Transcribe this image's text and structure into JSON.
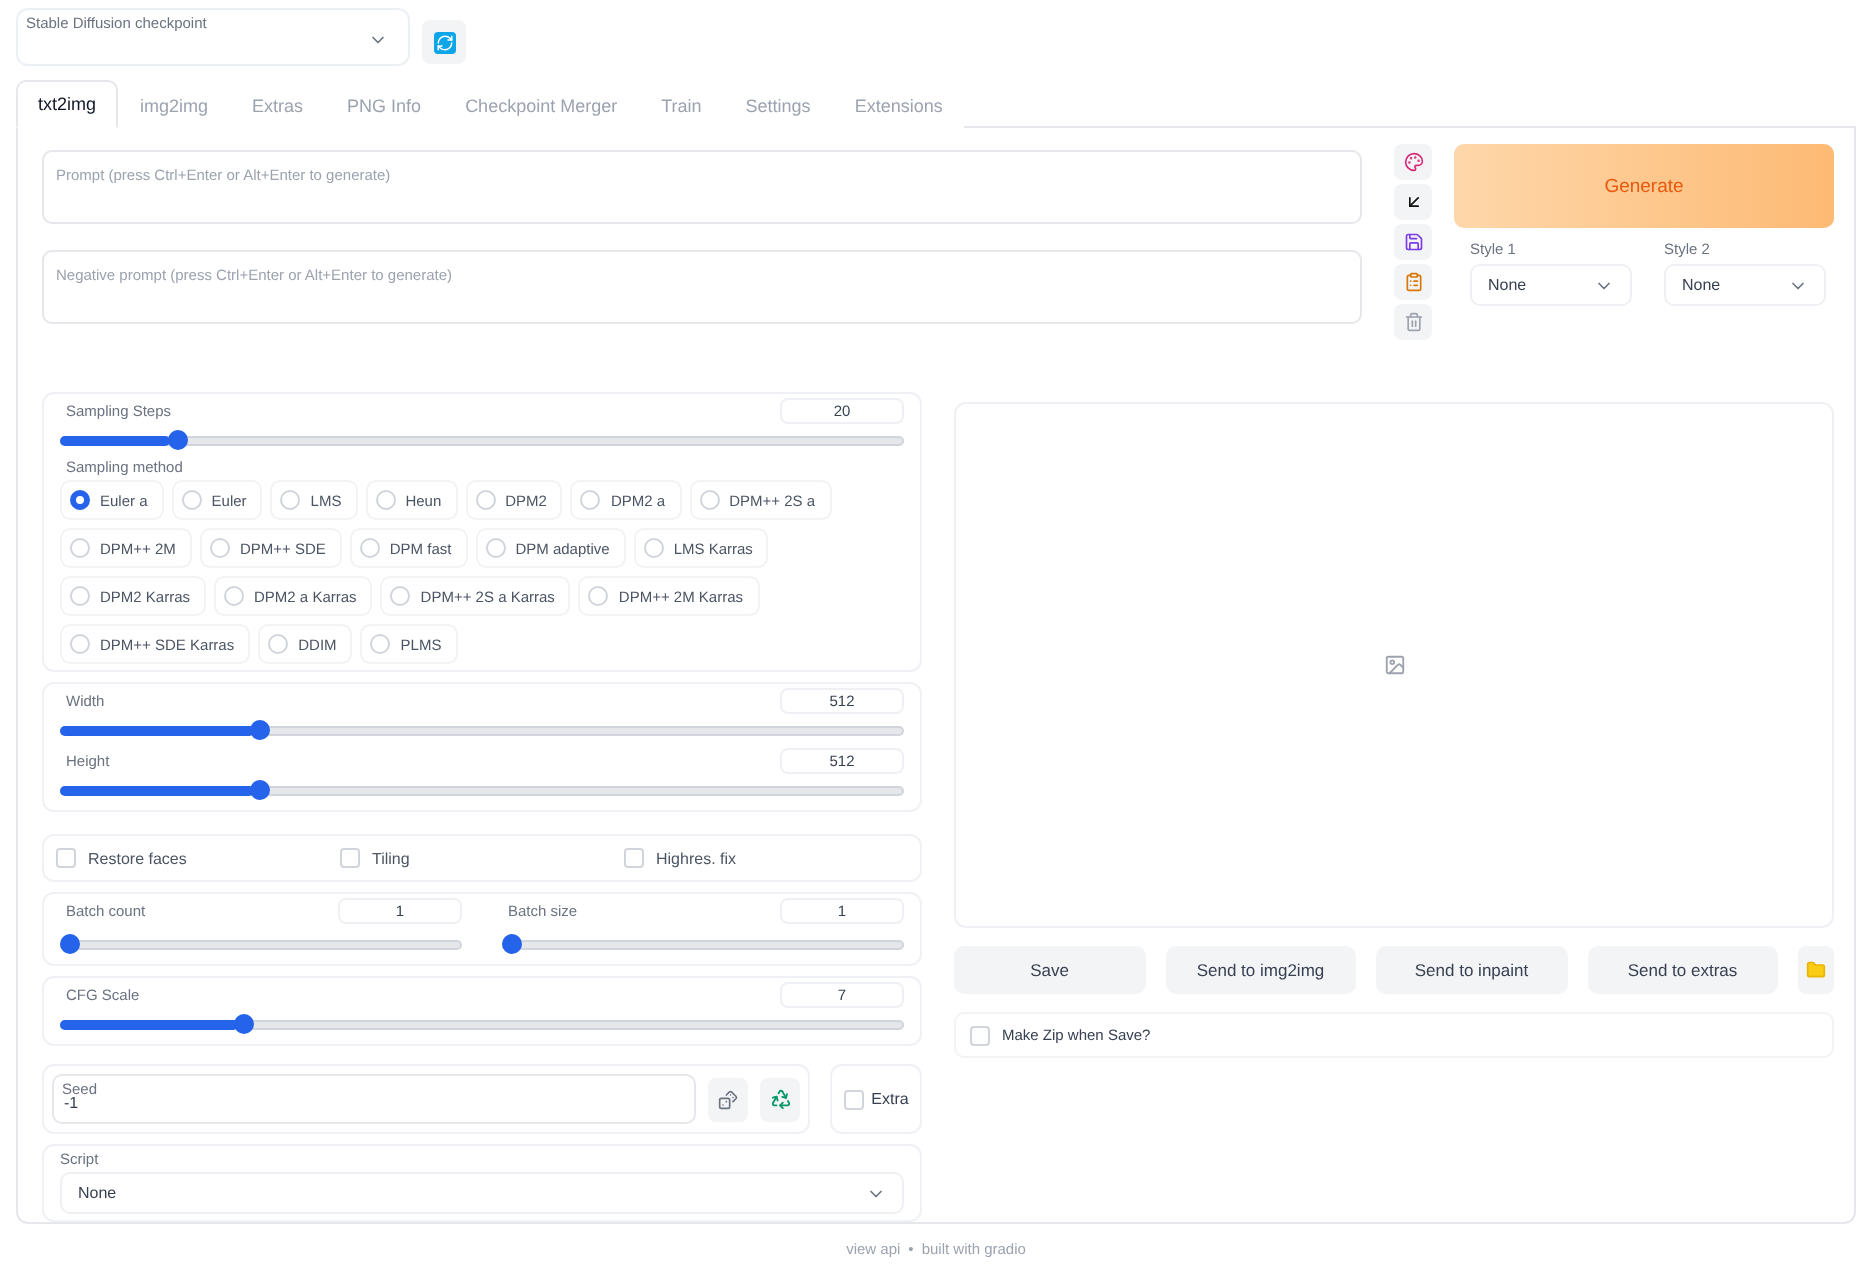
{
  "checkpoint": {
    "label": "Stable Diffusion checkpoint"
  },
  "tabs": [
    {
      "label": "txt2img",
      "selected": true
    },
    {
      "label": "img2img",
      "selected": false
    },
    {
      "label": "Extras",
      "selected": false
    },
    {
      "label": "PNG Info",
      "selected": false
    },
    {
      "label": "Checkpoint Merger",
      "selected": false
    },
    {
      "label": "Train",
      "selected": false
    },
    {
      "label": "Settings",
      "selected": false
    },
    {
      "label": "Extensions",
      "selected": false
    }
  ],
  "prompt": {
    "placeholder": "Prompt (press Ctrl+Enter or Alt+Enter to generate)"
  },
  "negative_prompt": {
    "placeholder": "Negative prompt (press Ctrl+Enter or Alt+Enter to generate)"
  },
  "generate_button": "Generate",
  "styles": [
    {
      "label": "Style 1",
      "value": "None"
    },
    {
      "label": "Style 2",
      "value": "None"
    }
  ],
  "sampling_steps": {
    "label": "Sampling Steps",
    "value": "20",
    "level": 0.13
  },
  "sampling_method": {
    "label": "Sampling method",
    "options": [
      {
        "label": "Euler a",
        "selected": true
      },
      {
        "label": "Euler",
        "selected": false
      },
      {
        "label": "LMS",
        "selected": false
      },
      {
        "label": "Heun",
        "selected": false
      },
      {
        "label": "DPM2",
        "selected": false
      },
      {
        "label": "DPM2 a",
        "selected": false
      },
      {
        "label": "DPM++ 2S a",
        "selected": false
      },
      {
        "label": "DPM++ 2M",
        "selected": false
      },
      {
        "label": "DPM++ SDE",
        "selected": false
      },
      {
        "label": "DPM fast",
        "selected": false
      },
      {
        "label": "DPM adaptive",
        "selected": false
      },
      {
        "label": "LMS Karras",
        "selected": false
      },
      {
        "label": "DPM2 Karras",
        "selected": false
      },
      {
        "label": "DPM2 a Karras",
        "selected": false
      },
      {
        "label": "DPM++ 2S a Karras",
        "selected": false
      },
      {
        "label": "DPM++ 2M Karras",
        "selected": false
      },
      {
        "label": "DPM++ SDE Karras",
        "selected": false
      },
      {
        "label": "DDIM",
        "selected": false
      },
      {
        "label": "PLMS",
        "selected": false
      }
    ]
  },
  "size_sliders": [
    {
      "label": "Width",
      "value": "512",
      "level": 0.23
    },
    {
      "label": "Height",
      "value": "512",
      "level": 0.23
    }
  ],
  "options": [
    {
      "label": "Restore faces",
      "checked": false
    },
    {
      "label": "Tiling",
      "checked": false
    },
    {
      "label": "Highres. fix",
      "checked": false
    }
  ],
  "batch_sliders": [
    {
      "label": "Batch count",
      "value": "1",
      "level": 0
    },
    {
      "label": "Batch size",
      "value": "1",
      "level": 0
    }
  ],
  "cfg_scale": {
    "label": "CFG Scale",
    "value": "7",
    "level": 0.21
  },
  "seed": {
    "label": "Seed",
    "value": "-1"
  },
  "extra": {
    "label": "Extra",
    "checked": false
  },
  "script": {
    "label": "Script",
    "value": "None"
  },
  "output_buttons": [
    "Save",
    "Send to img2img",
    "Send to inpaint",
    "Send to extras"
  ],
  "zip": {
    "label": "Make Zip when Save?",
    "checked": false
  },
  "footer": {
    "links": [
      "view api",
      "built with gradio"
    ],
    "separator": "•"
  }
}
